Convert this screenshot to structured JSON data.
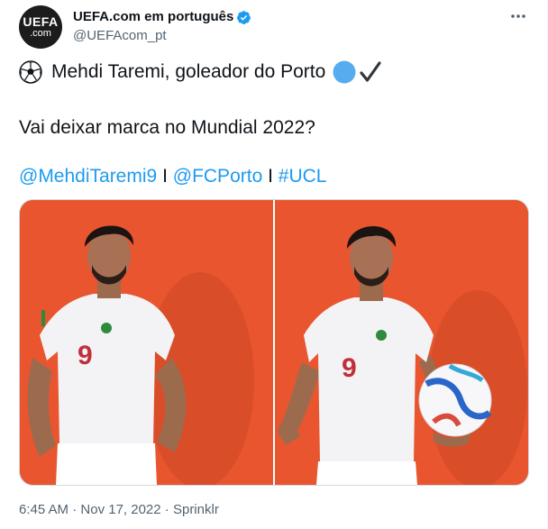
{
  "account": {
    "display_name": "UEFA.com em português",
    "handle": "@UEFAcom_pt",
    "avatar_line1": "UEFA",
    "avatar_line2": ".com",
    "verified": true
  },
  "tweet": {
    "line1": "Mehdi Taremi, goleador do Porto",
    "line2": "Vai deixar marca no Mundial 2022?",
    "mention1": "@MehdiTaremi9",
    "separator": "I",
    "mention2": "@FCPorto",
    "hashtag": "#UCL"
  },
  "meta": {
    "time": "6:45 AM",
    "dot": "·",
    "date": "Nov 17, 2022",
    "source": "Sprinklr"
  },
  "photos": [
    {
      "jersey_number": "9"
    },
    {
      "jersey_number": "9"
    }
  ],
  "colors": {
    "link": "#1d9bf0",
    "secondary_text": "#536471",
    "photo_background": "#e8552f",
    "verified": "#1d9bf0"
  },
  "icons": {
    "verified": "verified-badge-icon",
    "more": "more-options-icon",
    "ball_emoji": "soccer-ball-icon",
    "blue_circle_emoji": "blue-circle-icon",
    "check_emoji": "check-mark-icon"
  }
}
